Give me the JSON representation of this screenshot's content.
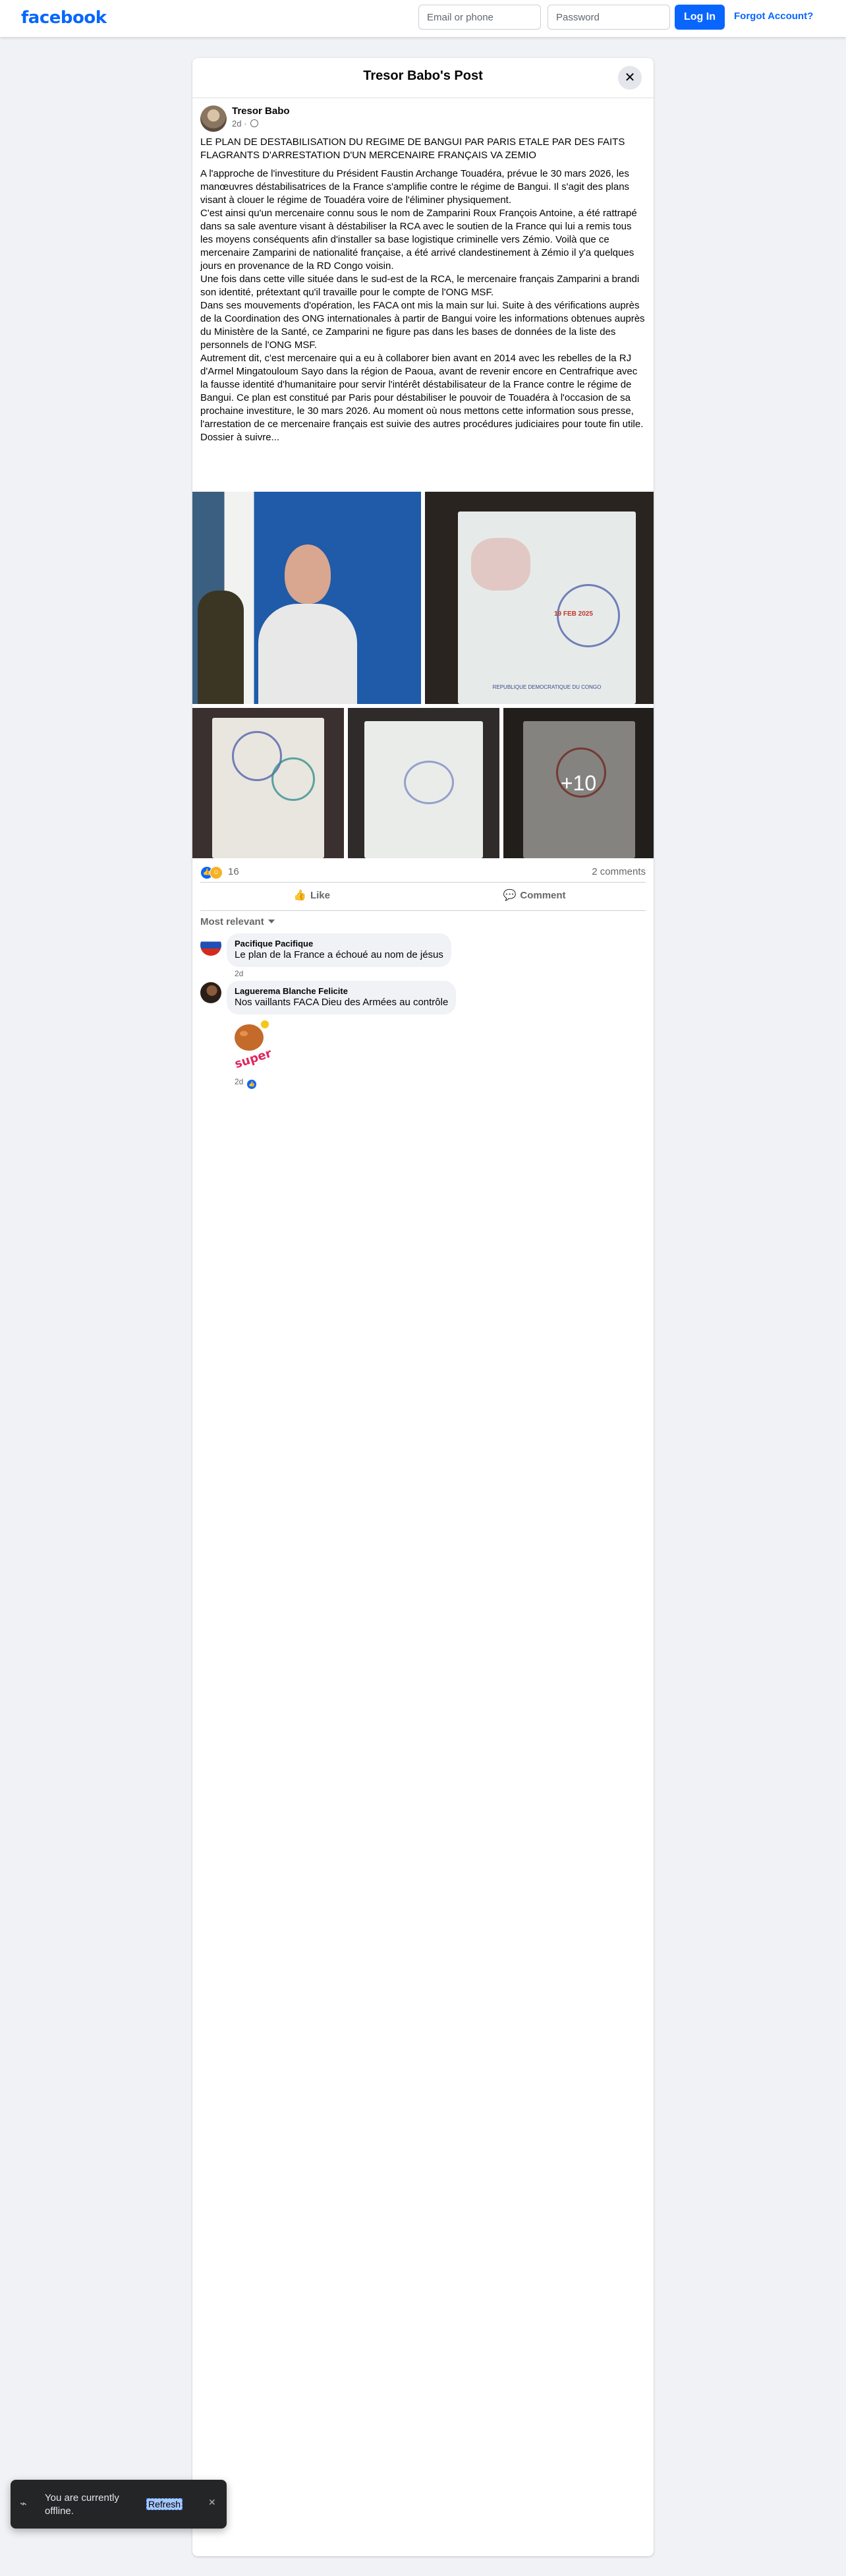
{
  "topbar": {
    "logo": "facebook",
    "email_placeholder": "Email or phone",
    "password_placeholder": "Password",
    "login_label": "Log In",
    "forgot_label": "Forgot Account?"
  },
  "post": {
    "title": "Tresor Babo's Post",
    "author": "Tresor Babo",
    "time": "2d ·",
    "headline": "LE PLAN DE DESTABILISATION DU REGIME DE BANGUI PAR PARIS ETALE PAR DES FAITS FLAGRANTS D'ARRESTATION D'UN MERCENAIRE FRANÇAIS VA ZEMIO",
    "paragraphs": [
      "A l'approche de l'investiture du Président Faustin Archange Touadéra, prévue le 30 mars 2026, les manœuvres déstabilisatrices de la France s'amplifie contre le régime de Bangui. Il s'agit des plans visant à clouer le régime de Touadéra voire de l'éliminer physiquement.",
      "C'est ainsi qu'un mercenaire connu sous le nom de Zamparini Roux François Antoine, a été rattrapé dans sa sale aventure visant à déstabiliser la RCA avec le soutien de la France qui lui a remis tous les moyens conséquents afin d'installer sa base logistique criminelle vers Zémio. Voilà que ce mercenaire Zamparini de nationalité française, a été arrivé clandestinement à Zémio il y'a quelques jours en provenance de la RD Congo voisin.",
      "Une fois dans cette ville située dans le sud-est de la RCA, le mercenaire français Zamparini a brandi son identité, prétextant qu'il travaille pour le compte de l'ONG MSF.",
      "Dans ses mouvements d'opération, les FACA ont mis la main sur lui. Suite à des vérifications auprès de la Coordination des ONG internationales à partir de Bangui voire les informations obtenues auprès du Ministère de la Santé, ce Zamparini ne figure pas dans les bases de données de la liste des personnels de l'ONG MSF.",
      "Autrement dit, c'est mercenaire qui a eu à collaborer bien avant en 2014 avec les rebelles de la RJ d'Armel Mingatouloum Sayo dans la région de Paoua, avant de revenir encore en Centrafrique avec la fausse identité d'humanitaire pour servir l'intérêt déstabilisateur de la France contre le régime de Bangui. Ce plan est constitué par Paris pour déstabiliser le pouvoir de Touadéra à l'occasion de sa prochaine investiture, le 30 mars 2026. Au moment où nous mettons cette information sous presse, l'arrestation de ce mercenaire français est suivie des autres procédures judiciaires pour toute fin utile.",
      "Dossier à suivre..."
    ],
    "passport_stamp": "19 FEB 2025",
    "passport_header": "REPUBLIQUE DEMOCRATIQUE DU CONGO",
    "more_photos": "+10",
    "reaction_count": "16",
    "comment_count": "2 comments",
    "like_label": "Like",
    "comment_label": "Comment",
    "sort_label": "Most relevant"
  },
  "comments": [
    {
      "name": "Pacifique Pacifique",
      "text": "Le plan de la France a échoué au nom de jésus",
      "time": "2d"
    },
    {
      "name": "Laguerema Blanche Felicite",
      "text": "Nos vaillants FACA Dieu des Armées au contrôle",
      "time": "2d",
      "sticker": "super"
    }
  ],
  "toast": {
    "message": "You are currently offline.",
    "refresh_label": "Refresh"
  },
  "colors": {
    "brand": "#0866ff",
    "background": "#f0f2f5"
  }
}
